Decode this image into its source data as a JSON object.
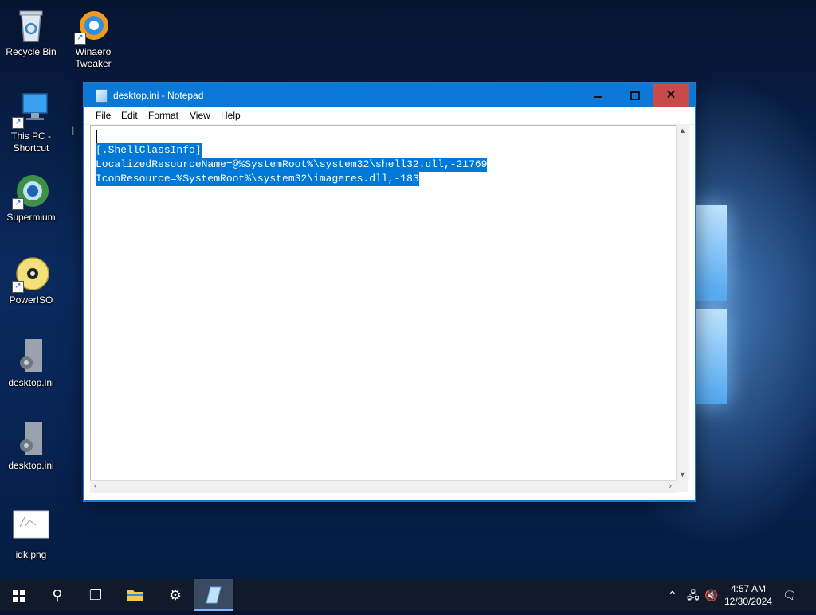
{
  "desktop": {
    "icons": [
      {
        "label": "Recycle Bin",
        "icon": "recycle-bin-icon"
      },
      {
        "label": "Winaero Tweaker",
        "icon": "winaero-tweaker-icon"
      },
      {
        "label": "This PC - Shortcut",
        "icon": "computer-icon"
      },
      {
        "label": "Supermium",
        "icon": "supermium-browser-icon"
      },
      {
        "label": "PowerISO",
        "icon": "poweriso-disc-icon"
      },
      {
        "label": "desktop.ini",
        "icon": "settings-file-icon"
      },
      {
        "label": "desktop.ini",
        "icon": "settings-file-icon"
      },
      {
        "label": "idk.png",
        "icon": "image-file-icon"
      }
    ]
  },
  "window": {
    "title": "desktop.ini - Notepad",
    "menu": [
      "File",
      "Edit",
      "Format",
      "View",
      "Help"
    ],
    "editor_lines": [
      "[.ShellClassInfo]",
      "LocalizedResourceName=@%SystemRoot%\\system32\\shell32.dll,-21769",
      "IconResource=%SystemRoot%\\system32\\imageres.dll,-183"
    ],
    "selection_color": "#0078d7",
    "titlebar_color": "#0b78d7"
  },
  "taskbar": {
    "time": "4:57 AM",
    "date": "12/30/2024",
    "tray_icons": [
      "chevron-up-icon",
      "network-icon",
      "volume-muted-icon",
      "notification-icon"
    ]
  }
}
